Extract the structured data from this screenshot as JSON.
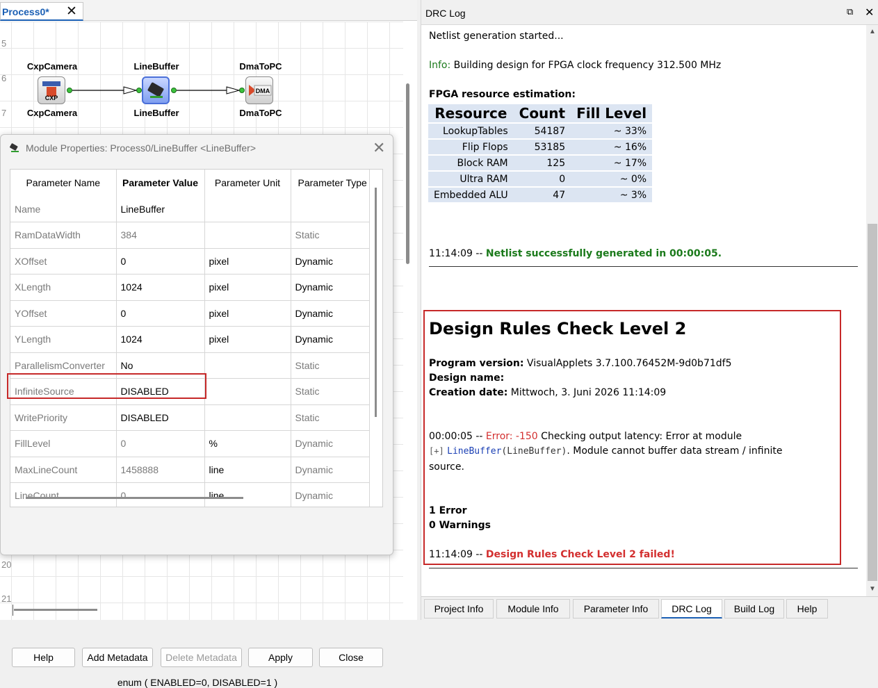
{
  "process_tab": {
    "title": "Process0*",
    "close": "✕"
  },
  "canvas": {
    "row_numbers": [
      "5",
      "6",
      "7",
      "20",
      "21"
    ],
    "modules": [
      {
        "label_top": "CxpCamera",
        "label_bottom": "CxpCamera",
        "icon_text": "CXP"
      },
      {
        "label_top": "LineBuffer",
        "label_bottom": "LineBuffer"
      },
      {
        "label_top": "DmaToPC",
        "label_bottom": "DmaToPC",
        "icon_text": "DMA"
      }
    ]
  },
  "dialog": {
    "title": "Module Properties: Process0/LineBuffer <LineBuffer>",
    "close": "✕",
    "columns": [
      "Parameter Name",
      "Parameter Value",
      "Parameter Unit",
      "Parameter Type"
    ],
    "rows": [
      {
        "name": "Name",
        "value": "LineBuffer",
        "unit": "",
        "type": ""
      },
      {
        "name": "RamDataWidth",
        "value": "384",
        "unit": "",
        "type": "Static"
      },
      {
        "name": "XOffset",
        "value": "0",
        "unit": "pixel",
        "type": "Dynamic"
      },
      {
        "name": "XLength",
        "value": "1024",
        "unit": "pixel",
        "type": "Dynamic"
      },
      {
        "name": "YOffset",
        "value": "0",
        "unit": "pixel",
        "type": "Dynamic"
      },
      {
        "name": "YLength",
        "value": "1024",
        "unit": "pixel",
        "type": "Dynamic"
      },
      {
        "name": "ParallelismConverter",
        "value": "No",
        "unit": "",
        "type": "Static"
      },
      {
        "name": "InfiniteSource",
        "value": "DISABLED",
        "unit": "",
        "type": "Static"
      },
      {
        "name": "WritePriority",
        "value": "DISABLED",
        "unit": "",
        "type": "Static"
      },
      {
        "name": "FillLevel",
        "value": "0",
        "unit": "%",
        "type": "Dynamic"
      },
      {
        "name": "MaxLineCount",
        "value": "1458888",
        "unit": "line",
        "type": "Dynamic"
      },
      {
        "name": "LineCount",
        "value": "0",
        "unit": "line",
        "type": "Dynamic"
      }
    ],
    "buttons": {
      "help": "Help",
      "add_metadata": "Add Metadata",
      "delete_metadata": "Delete Metadata",
      "apply": "Apply",
      "close": "Close"
    },
    "enum_hint": "enum ( ENABLED=0, DISABLED=1 )"
  },
  "drc_panel": {
    "title": "DRC Log",
    "restore": "⧉",
    "close": "✕",
    "log": {
      "netlist_started": "Netlist generation started...",
      "info_label": "Info:",
      "info_text": " Building design for FPGA clock frequency 312.500 MHz",
      "resource_heading": "FPGA resource estimation:",
      "resource_columns": [
        "Resource",
        "Count",
        "Fill Level"
      ],
      "resources": [
        {
          "name": "LookupTables",
          "count": "54187",
          "fill": "~ 33%"
        },
        {
          "name": "Flip Flops",
          "count": "53185",
          "fill": "~ 16%"
        },
        {
          "name": "Block RAM",
          "count": "125",
          "fill": "~ 17%"
        },
        {
          "name": "Ultra RAM",
          "count": "0",
          "fill": "~ 0%"
        },
        {
          "name": "Embedded ALU",
          "count": "47",
          "fill": "~ 3%"
        }
      ],
      "netlist_time": "11:14:09 -- ",
      "netlist_success": "Netlist successfully generated in 00:00:05.",
      "drc_heading": "Design Rules Check Level 2",
      "program_version_label": "Program version:",
      "program_version": " VisualApplets 3.7.100.76452M-9d0b71df5",
      "design_name_label": "Design name:",
      "creation_date_label": "Creation date:",
      "creation_date": " Mittwoch, 3. Juni 2026 11:14:09",
      "error_time": "00:00:05 -- ",
      "error_label": "Error: -150",
      "error_text": " Checking output latency: Error at module",
      "error_expand": "[+]",
      "error_module": "LineBuffer",
      "error_module_type": "(LineBuffer)",
      "error_text2": ". Module cannot buffer data stream / infinite",
      "error_text3": "source.",
      "error_count": "1 Error",
      "warning_count": "0 Warnings",
      "fail_time": "11:14:09 -- ",
      "fail_text": "Design Rules Check Level 2 failed!"
    },
    "tabs": [
      "Project Info",
      "Module Info",
      "Parameter Info",
      "DRC Log",
      "Build Log",
      "Help"
    ],
    "active_tab": "DRC Log"
  },
  "colors": {
    "accent": "#1a5fb4",
    "error": "#d32f2f",
    "success": "#1b7a1b",
    "highlight_box": "#c62828"
  }
}
